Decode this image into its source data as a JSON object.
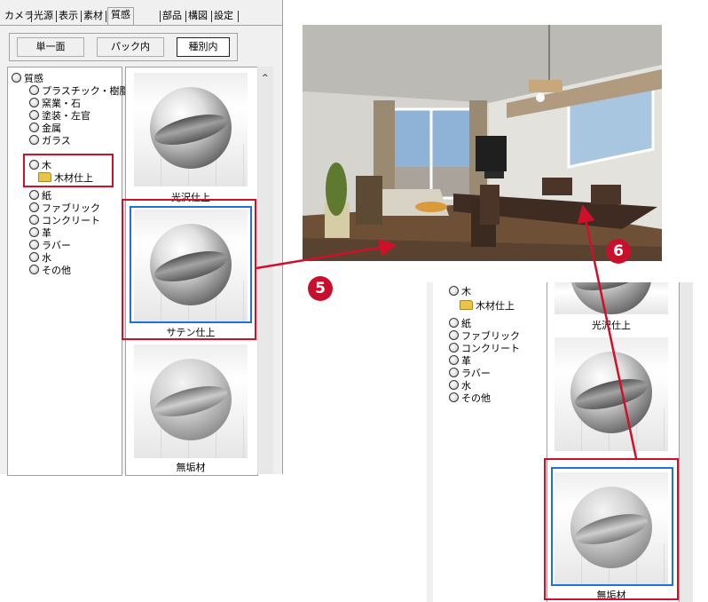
{
  "tabs": [
    "カメラ",
    "光源",
    "表示",
    "素材",
    "質感",
    "部品",
    "構図",
    "設定"
  ],
  "active_tab": "質感",
  "scope_buttons": [
    "単一面",
    "パック内",
    "種別内"
  ],
  "selected_scope": "種別内",
  "tree": {
    "root": "質感",
    "items": [
      "プラスチック・樹脂",
      "窯業・石",
      "塗装・左官",
      "金属",
      "ガラス",
      "木",
      "紙",
      "ファブリック",
      "コンクリート",
      "革",
      "ラバー",
      "水",
      "その他"
    ],
    "subitem": "木材仕上"
  },
  "materials": [
    "光沢仕上",
    "サテン仕上",
    "無垢材"
  ],
  "selected_material_step5": "サテン仕上",
  "selected_material_step6": "無垢材",
  "steps": [
    "5",
    "6"
  ],
  "colors": {
    "highlight": "#d0102b",
    "selection": "#1f73d8",
    "badge": "#c8102e"
  }
}
